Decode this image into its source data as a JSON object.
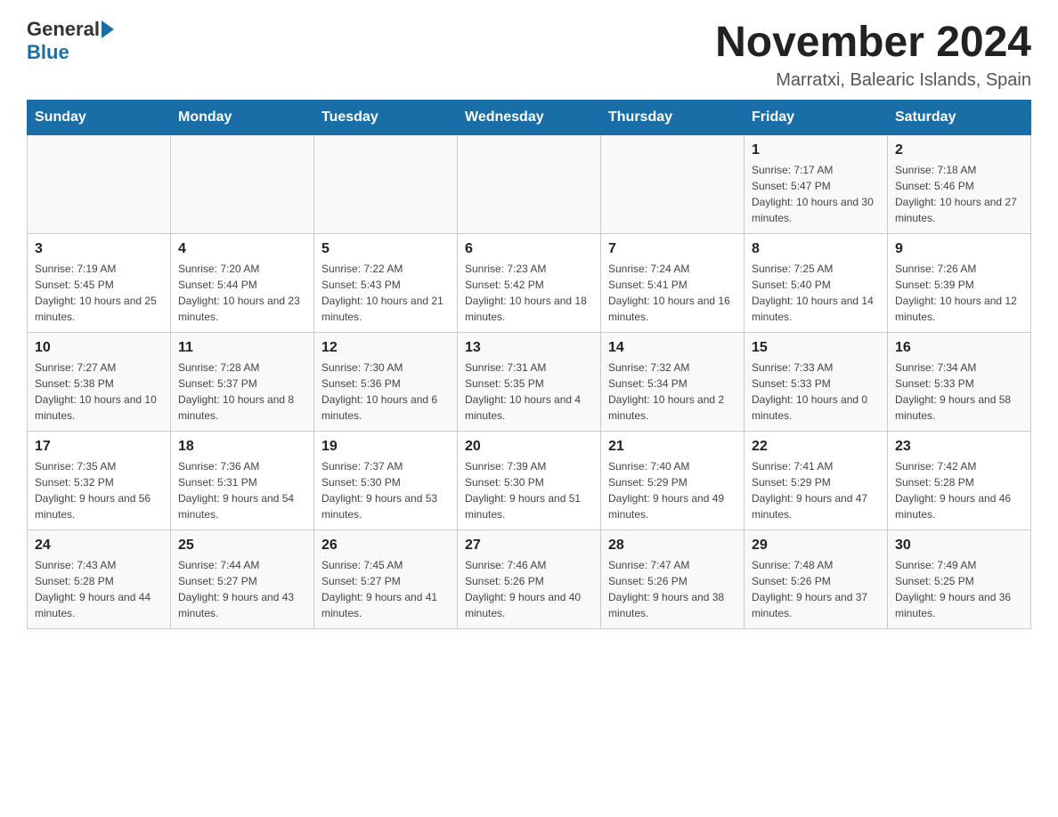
{
  "logo": {
    "general": "General",
    "blue": "Blue"
  },
  "title": "November 2024",
  "subtitle": "Marratxi, Balearic Islands, Spain",
  "weekdays": [
    "Sunday",
    "Monday",
    "Tuesday",
    "Wednesday",
    "Thursday",
    "Friday",
    "Saturday"
  ],
  "weeks": [
    [
      {
        "day": "",
        "info": ""
      },
      {
        "day": "",
        "info": ""
      },
      {
        "day": "",
        "info": ""
      },
      {
        "day": "",
        "info": ""
      },
      {
        "day": "",
        "info": ""
      },
      {
        "day": "1",
        "info": "Sunrise: 7:17 AM\nSunset: 5:47 PM\nDaylight: 10 hours and 30 minutes."
      },
      {
        "day": "2",
        "info": "Sunrise: 7:18 AM\nSunset: 5:46 PM\nDaylight: 10 hours and 27 minutes."
      }
    ],
    [
      {
        "day": "3",
        "info": "Sunrise: 7:19 AM\nSunset: 5:45 PM\nDaylight: 10 hours and 25 minutes."
      },
      {
        "day": "4",
        "info": "Sunrise: 7:20 AM\nSunset: 5:44 PM\nDaylight: 10 hours and 23 minutes."
      },
      {
        "day": "5",
        "info": "Sunrise: 7:22 AM\nSunset: 5:43 PM\nDaylight: 10 hours and 21 minutes."
      },
      {
        "day": "6",
        "info": "Sunrise: 7:23 AM\nSunset: 5:42 PM\nDaylight: 10 hours and 18 minutes."
      },
      {
        "day": "7",
        "info": "Sunrise: 7:24 AM\nSunset: 5:41 PM\nDaylight: 10 hours and 16 minutes."
      },
      {
        "day": "8",
        "info": "Sunrise: 7:25 AM\nSunset: 5:40 PM\nDaylight: 10 hours and 14 minutes."
      },
      {
        "day": "9",
        "info": "Sunrise: 7:26 AM\nSunset: 5:39 PM\nDaylight: 10 hours and 12 minutes."
      }
    ],
    [
      {
        "day": "10",
        "info": "Sunrise: 7:27 AM\nSunset: 5:38 PM\nDaylight: 10 hours and 10 minutes."
      },
      {
        "day": "11",
        "info": "Sunrise: 7:28 AM\nSunset: 5:37 PM\nDaylight: 10 hours and 8 minutes."
      },
      {
        "day": "12",
        "info": "Sunrise: 7:30 AM\nSunset: 5:36 PM\nDaylight: 10 hours and 6 minutes."
      },
      {
        "day": "13",
        "info": "Sunrise: 7:31 AM\nSunset: 5:35 PM\nDaylight: 10 hours and 4 minutes."
      },
      {
        "day": "14",
        "info": "Sunrise: 7:32 AM\nSunset: 5:34 PM\nDaylight: 10 hours and 2 minutes."
      },
      {
        "day": "15",
        "info": "Sunrise: 7:33 AM\nSunset: 5:33 PM\nDaylight: 10 hours and 0 minutes."
      },
      {
        "day": "16",
        "info": "Sunrise: 7:34 AM\nSunset: 5:33 PM\nDaylight: 9 hours and 58 minutes."
      }
    ],
    [
      {
        "day": "17",
        "info": "Sunrise: 7:35 AM\nSunset: 5:32 PM\nDaylight: 9 hours and 56 minutes."
      },
      {
        "day": "18",
        "info": "Sunrise: 7:36 AM\nSunset: 5:31 PM\nDaylight: 9 hours and 54 minutes."
      },
      {
        "day": "19",
        "info": "Sunrise: 7:37 AM\nSunset: 5:30 PM\nDaylight: 9 hours and 53 minutes."
      },
      {
        "day": "20",
        "info": "Sunrise: 7:39 AM\nSunset: 5:30 PM\nDaylight: 9 hours and 51 minutes."
      },
      {
        "day": "21",
        "info": "Sunrise: 7:40 AM\nSunset: 5:29 PM\nDaylight: 9 hours and 49 minutes."
      },
      {
        "day": "22",
        "info": "Sunrise: 7:41 AM\nSunset: 5:29 PM\nDaylight: 9 hours and 47 minutes."
      },
      {
        "day": "23",
        "info": "Sunrise: 7:42 AM\nSunset: 5:28 PM\nDaylight: 9 hours and 46 minutes."
      }
    ],
    [
      {
        "day": "24",
        "info": "Sunrise: 7:43 AM\nSunset: 5:28 PM\nDaylight: 9 hours and 44 minutes."
      },
      {
        "day": "25",
        "info": "Sunrise: 7:44 AM\nSunset: 5:27 PM\nDaylight: 9 hours and 43 minutes."
      },
      {
        "day": "26",
        "info": "Sunrise: 7:45 AM\nSunset: 5:27 PM\nDaylight: 9 hours and 41 minutes."
      },
      {
        "day": "27",
        "info": "Sunrise: 7:46 AM\nSunset: 5:26 PM\nDaylight: 9 hours and 40 minutes."
      },
      {
        "day": "28",
        "info": "Sunrise: 7:47 AM\nSunset: 5:26 PM\nDaylight: 9 hours and 38 minutes."
      },
      {
        "day": "29",
        "info": "Sunrise: 7:48 AM\nSunset: 5:26 PM\nDaylight: 9 hours and 37 minutes."
      },
      {
        "day": "30",
        "info": "Sunrise: 7:49 AM\nSunset: 5:25 PM\nDaylight: 9 hours and 36 minutes."
      }
    ]
  ]
}
